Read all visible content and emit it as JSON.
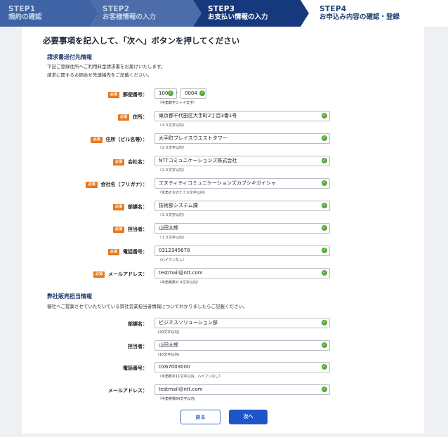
{
  "steps": [
    {
      "num": "STEP1",
      "label": "規約の確認"
    },
    {
      "num": "STEP2",
      "label": "お客様情報の入力"
    },
    {
      "num": "STEP3",
      "label": "お支払い情報の入力"
    },
    {
      "num": "STEP4",
      "label": "お申込み内容の確認・登録"
    }
  ],
  "page_title": "必要事項を記入して、「次へ」ボタンを押してください",
  "billing": {
    "heading": "請求書送付先情報",
    "desc1": "下記ご登録住所へご利用料金請求書をお届けいたします。",
    "desc2": "請求に関するお問合せ先連絡先をご記載ください。",
    "required_badge": "必須",
    "zip": {
      "label": "郵便番号：",
      "part1": "100",
      "part2": "0004",
      "dash": "-",
      "hint": "（半角数字３＋４文字）"
    },
    "address": {
      "label": "住所：",
      "value": "東京都千代田区大手町2丁目3番1号",
      "hint": "（４０文字以内）"
    },
    "building": {
      "label": "住所（ビル名等）：",
      "value": "大手町プレイスウエストタワー",
      "hint": "（２０文字以内）"
    },
    "company": {
      "label": "会社名：",
      "value": "NTTコミュニケーションズ株式会社",
      "hint": "（２０文字以内）"
    },
    "company_kana": {
      "label": "会社名（フリガナ）：",
      "value": "エヌティティコミュニケーションズカブシキガイシャ",
      "hint": "（全角カタカナ３０文字以内）"
    },
    "department": {
      "label": "部課名：",
      "value": "技術部システム課",
      "hint": "（２０文字以内）"
    },
    "person": {
      "label": "担当者：",
      "value": "山田太郎",
      "hint": "（１０文字以内）"
    },
    "phone": {
      "label": "電話番号：",
      "value": "0312345678",
      "hint": "（ハイフンなし）"
    },
    "email": {
      "label": "メールアドレス：",
      "value": "testmail@ntt.com",
      "hint": "（半角英数６４文字以内）"
    }
  },
  "sales": {
    "heading": "弊社販売担当情報",
    "desc": "御社へご提案させていただいている弊社営業担当者情報についてわかりましたらご記載ください。",
    "department": {
      "label": "部課名：",
      "value": "ビジネスソリューション部",
      "hint": "(20文字以内)"
    },
    "person": {
      "label": "担当者：",
      "value": "山田太郎",
      "hint": "(10文字以内)"
    },
    "phone": {
      "label": "電話番号：",
      "value": "0367003000",
      "hint": "（半角数字11文字以内、ハイフンなし）"
    },
    "email": {
      "label": "メールアドレス：",
      "value": "testmail@ntt.com",
      "hint": "（半角英数64文字以内）"
    }
  },
  "buttons": {
    "back": "戻る",
    "next": "次へ"
  },
  "colors": {
    "accent": "#1e56c9",
    "required": "#e8791e",
    "valid": "#58a83a",
    "step_active": "#1b3f86"
  }
}
